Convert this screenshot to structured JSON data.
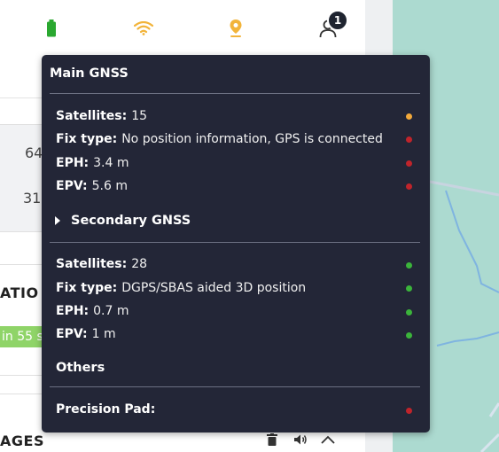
{
  "topbar": {
    "icons": [
      "battery-icon",
      "wifi-icon",
      "location-pin-icon",
      "user-icon"
    ],
    "notification_count": "1",
    "colors": {
      "battery": "#2aa830",
      "wifi": "#f2b43a",
      "location": "#f2b43a"
    }
  },
  "background": {
    "stat_top": "64",
    "stat_bottom": "31",
    "section_title": "ATIO",
    "status_pill": "in  55 s",
    "messages_title": "AGES"
  },
  "tooltip": {
    "main": {
      "title": "Main GNSS",
      "rows": [
        {
          "label": "Satellites:",
          "value": "15",
          "status_color": "#f2a93b"
        },
        {
          "label": "Fix type:",
          "value": "No position information, GPS is connected",
          "status_color": "#c0242b"
        },
        {
          "label": "EPH:",
          "value": "3.4 m",
          "status_color": "#c0242b"
        },
        {
          "label": "EPV:",
          "value": "5.6 m",
          "status_color": "#c0242b"
        }
      ]
    },
    "secondary": {
      "title": "Secondary GNSS",
      "rows": [
        {
          "label": "Satellites:",
          "value": "28",
          "status_color": "#3bb43b"
        },
        {
          "label": "Fix type:",
          "value": "DGPS/SBAS aided 3D position",
          "status_color": "#3bb43b"
        },
        {
          "label": "EPH:",
          "value": "0.7 m",
          "status_color": "#3bb43b"
        },
        {
          "label": "EPV:",
          "value": "1 m",
          "status_color": "#3bb43b"
        }
      ]
    },
    "others": {
      "title": "Others",
      "rows": [
        {
          "label": "Precision Pad:",
          "value": "",
          "status_color": "#c0242b"
        }
      ]
    }
  },
  "footer_icons": [
    "trash-icon",
    "speaker-icon",
    "chevron-up-icon"
  ]
}
